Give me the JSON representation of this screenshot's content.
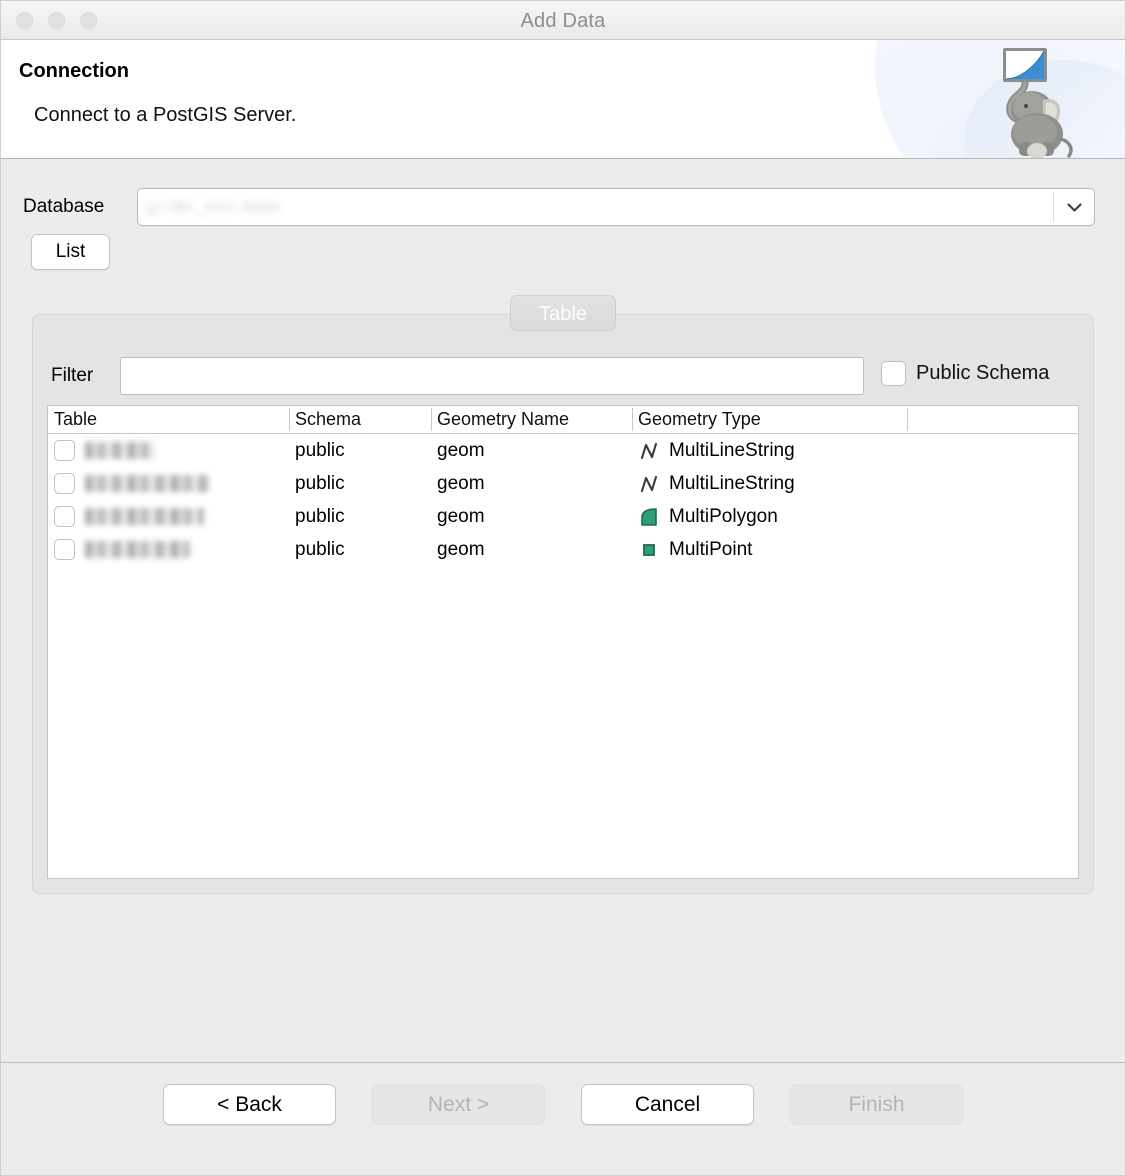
{
  "window": {
    "title": "Add Data",
    "traffic_lights": [
      "close",
      "minimize",
      "zoom"
    ]
  },
  "header": {
    "title": "Connection",
    "subtitle": "Connect to a PostGIS Server.",
    "logo_icon": "postgis-elephant-logo"
  },
  "form": {
    "database_label": "Database",
    "database_value": "",
    "database_redacted": true,
    "dropdown_icon": "chevron-down-icon",
    "list_button_label": "List"
  },
  "tabs": [
    {
      "label": "Table",
      "selected": true
    }
  ],
  "filter": {
    "label": "Filter",
    "value": "",
    "placeholder": ""
  },
  "public_schema": {
    "label": "Public Schema",
    "checked": false
  },
  "table": {
    "columns": [
      "Table",
      "Schema",
      "Geometry Name",
      "Geometry Type",
      ""
    ],
    "rows": [
      {
        "checked": false,
        "table": "",
        "table_redacted": true,
        "table_blur_width": 70,
        "schema": "public",
        "geometry_name": "geom",
        "geometry_type": "MultiLineString",
        "geometry_icon": "multilinestring-icon"
      },
      {
        "checked": false,
        "table": "",
        "table_redacted": true,
        "table_blur_width": 125,
        "schema": "public",
        "geometry_name": "geom",
        "geometry_type": "MultiLineString",
        "geometry_icon": "multilinestring-icon"
      },
      {
        "checked": false,
        "table": "",
        "table_redacted": true,
        "table_blur_width": 119,
        "schema": "public",
        "geometry_name": "geom",
        "geometry_type": "MultiPolygon",
        "geometry_icon": "multipolygon-icon"
      },
      {
        "checked": false,
        "table": "",
        "table_redacted": true,
        "table_blur_width": 105,
        "schema": "public",
        "geometry_name": "geom",
        "geometry_type": "MultiPoint",
        "geometry_icon": "multipoint-icon"
      }
    ]
  },
  "footer": {
    "buttons": [
      {
        "label": "< Back",
        "enabled": true
      },
      {
        "label": "Next >",
        "enabled": false
      },
      {
        "label": "Cancel",
        "enabled": true
      },
      {
        "label": "Finish",
        "enabled": false
      }
    ]
  },
  "colors": {
    "geometry_green": "#2e9e77",
    "geometry_green_dark": "#1d6b4f",
    "line_icon_gray": "#3a3a3a",
    "window_bg": "#ececec",
    "accent_blue": "#2f86d4"
  }
}
